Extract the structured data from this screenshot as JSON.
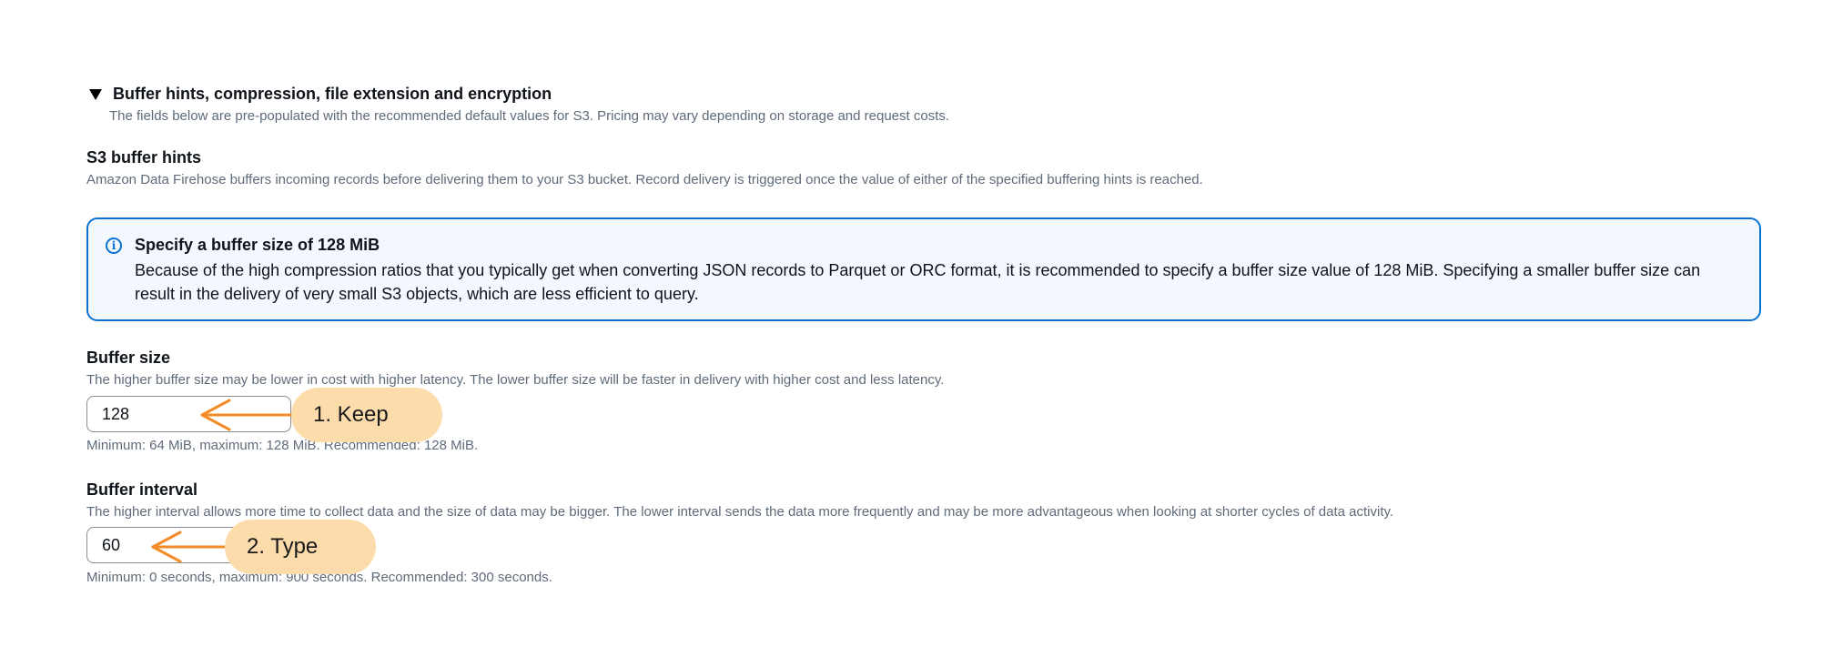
{
  "section": {
    "title": "Buffer hints, compression, file extension and encryption",
    "description": "The fields below are pre-populated with the recommended default values for S3. Pricing may vary depending on storage and request costs."
  },
  "s3_buffer_hints": {
    "heading": "S3 buffer hints",
    "description": "Amazon Data Firehose buffers incoming records before delivering them to your S3 bucket. Record delivery is triggered once the value of either of the specified buffering hints is reached."
  },
  "info": {
    "icon": "info-icon",
    "title": "Specify a buffer size of 128 MiB",
    "body": "Because of the high compression ratios that you typically get when converting JSON records to Parquet or ORC format, it is recommended to specify a buffer size value of 128 MiB. Specifying a smaller buffer size can result in the delivery of very small S3 objects, which are less efficient to query."
  },
  "buffer_size": {
    "label": "Buffer size",
    "description": "The higher buffer size may be lower in cost with higher latency. The lower buffer size will be faster in delivery with higher cost and less latency.",
    "value": "128",
    "constraint": "Minimum: 64 MiB, maximum: 128 MiB. Recommended: 128 MiB."
  },
  "buffer_interval": {
    "label": "Buffer interval",
    "description": "The higher interval allows more time to collect data and the size of data may be bigger. The lower interval sends the data more frequently and may be more advantageous when looking at shorter cycles of data activity.",
    "value": "60",
    "constraint": "Minimum: 0 seconds, maximum: 900 seconds. Recommended: 300 seconds."
  },
  "annotations": {
    "step1": "1. Keep",
    "step2": "2. Type",
    "accent": "#f28c28",
    "pill_color": "#fcdcab"
  },
  "colors": {
    "info_border": "#0972d3",
    "info_background": "#f2f8fd",
    "secondary_text": "#5f6b7a"
  }
}
